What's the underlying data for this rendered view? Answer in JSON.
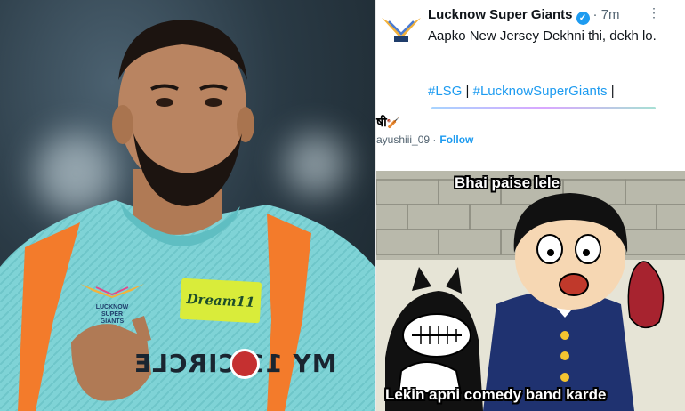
{
  "tweet": {
    "account_name": "Lucknow Super Giants",
    "time": "7m",
    "text": "Aapko New Jersey Dekhni thi, dekh lo.",
    "hashtag_1": "#LSG",
    "hashtag_2": "#LucknowSuperGiants",
    "separator": "|",
    "user_prefix": "षी",
    "user_handle": "ayushiii_09",
    "follow_label": "Follow"
  },
  "jersey": {
    "sponsor_text": "Dream11",
    "chest_badge": "LUCKNOW SUPER GIANTS",
    "logo_text": "MY 11 CIRCLE"
  },
  "meme": {
    "top_caption": "Bhai paise lele",
    "bottom_caption": "Lekin apni comedy band karde"
  },
  "colors": {
    "verified": "#1d9bf0",
    "hashtag": "#1d9bf0",
    "jersey": "#7fd3d6",
    "jersey_trim": "#f37b2b"
  }
}
